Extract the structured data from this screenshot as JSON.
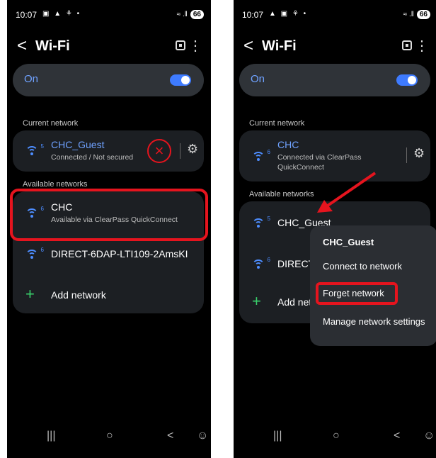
{
  "left": {
    "status": {
      "time": "10:07",
      "icons": "▣ ▲ ⚘ •",
      "signal": "≈ .‖",
      "battery": "66"
    },
    "header": {
      "back": "<",
      "title": "Wi-Fi",
      "more": "⋮"
    },
    "wifi_toggle": {
      "label": "On"
    },
    "current_section": "Current network",
    "current_network": {
      "name": "CHC_Guest",
      "status": "Connected / Not secured",
      "icon_tag": "5"
    },
    "available_section": "Available networks",
    "available": [
      {
        "name": "CHC",
        "status": "Available via ClearPass QuickConnect",
        "icon_tag": "6"
      },
      {
        "name": "DIRECT-6DAP-LTI109-2AmsKI",
        "icon_tag": "6"
      }
    ],
    "add_network": {
      "plus": "+",
      "label": "Add network"
    },
    "nav": {
      "recents": "|||",
      "home": "○",
      "back": "<",
      "accessibility": "☺"
    }
  },
  "right": {
    "status": {
      "time": "10:07",
      "icons": "▲ ▣ ⚘ •",
      "signal": "≈ .‖",
      "battery": "66"
    },
    "header": {
      "back": "<",
      "title": "Wi-Fi",
      "more": "⋮"
    },
    "wifi_toggle": {
      "label": "On"
    },
    "current_section": "Current network",
    "current_network": {
      "name": "CHC",
      "status_line1": "Connected via ClearPass",
      "status_line2": "QuickConnect",
      "icon_tag": "6"
    },
    "available_section": "Available networks",
    "available": [
      {
        "name": "CHC_Guest",
        "icon_tag": "5"
      },
      {
        "name": "DIRECT",
        "icon_tag": "6"
      }
    ],
    "add_network": {
      "plus": "+",
      "label": "Add net"
    },
    "context_menu": {
      "title": "CHC_Guest",
      "connect": "Connect to network",
      "forget": "Forget network",
      "manage": "Manage network settings"
    },
    "nav": {
      "recents": "|||",
      "home": "○",
      "back": "<",
      "accessibility": "☺"
    }
  },
  "colors": {
    "accent": "#3e7bff",
    "highlight": "#e5141e",
    "add": "#39d06b"
  }
}
